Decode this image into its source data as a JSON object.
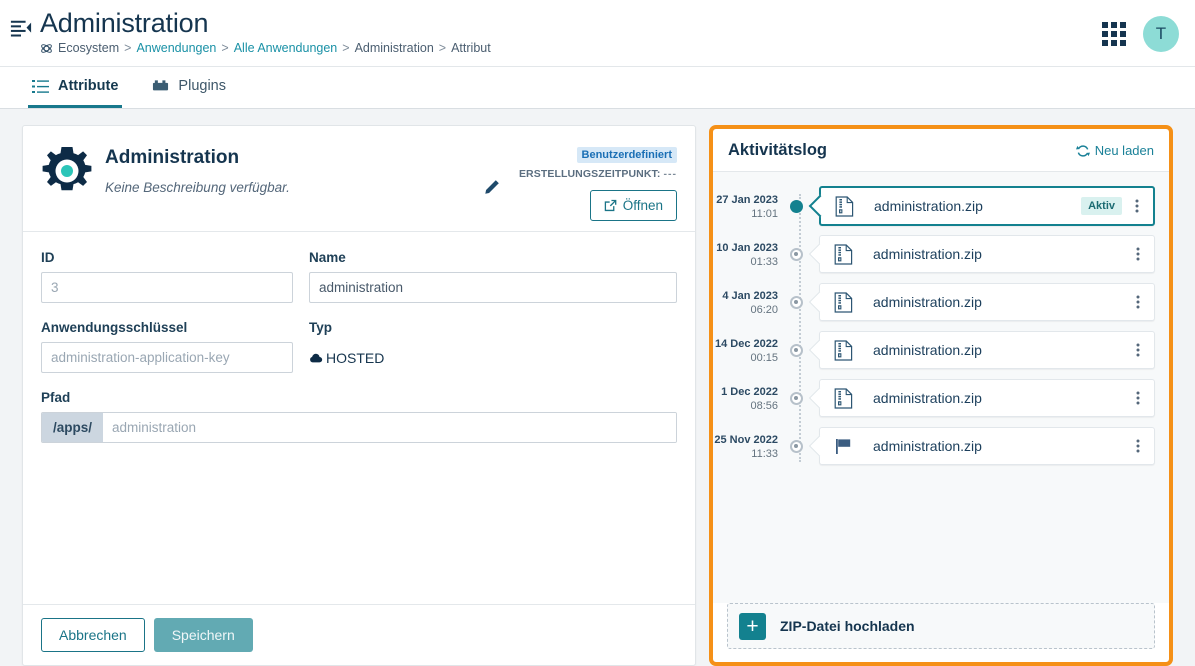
{
  "header": {
    "title": "Administration",
    "menu_icon": "collapse-menu-icon",
    "breadcrumb": [
      {
        "label": "Ecosystem",
        "link": false,
        "icon": "ecosystem-icon"
      },
      {
        "label": "Anwendungen",
        "link": true
      },
      {
        "label": "Alle Anwendungen",
        "link": true
      },
      {
        "label": "Administration",
        "link": false
      },
      {
        "label": "Attribut",
        "link": false
      }
    ],
    "separator": ">",
    "apps_grid_icon": "apps-grid-icon",
    "avatar_initial": "T"
  },
  "tabs": [
    {
      "label": "Attribute",
      "icon": "list-icon",
      "active": true
    },
    {
      "label": "Plugins",
      "icon": "plugin-brick-icon",
      "active": false
    }
  ],
  "app_card": {
    "icon": "gear-icon",
    "name": "Administration",
    "description": "Keine Beschreibung verfügbar.",
    "edit_icon": "pencil-icon",
    "badge": "Benutzerdefiniert",
    "created_label": "ERSTELLUNGSZEITPUNKT:",
    "created_value": "---",
    "open_button": "Öffnen",
    "open_icon": "external-link-icon"
  },
  "form": {
    "id": {
      "label": "ID",
      "value": "",
      "placeholder": "3"
    },
    "name": {
      "label": "Name",
      "value": "administration",
      "placeholder": ""
    },
    "app_key": {
      "label": "Anwendungsschlüssel",
      "value": "",
      "placeholder": "administration-application-key"
    },
    "type": {
      "label": "Typ",
      "value": "HOSTED",
      "icon": "cloud-icon"
    },
    "path": {
      "label": "Pfad",
      "prefix": "/apps/",
      "value": "",
      "placeholder": "administration"
    }
  },
  "footer": {
    "cancel": "Abbrechen",
    "save": "Speichern"
  },
  "activity_log": {
    "title": "Aktivitätslog",
    "reload_label": "Neu laden",
    "reload_icon": "refresh-icon",
    "kebab_icon": "kebab-menu-icon",
    "entries": [
      {
        "date": "27 Jan 2023",
        "time": "11:01",
        "file": "administration.zip",
        "icon": "zip-file-icon",
        "status": "Aktiv",
        "active": true
      },
      {
        "date": "10 Jan 2023",
        "time": "01:33",
        "file": "administration.zip",
        "icon": "zip-file-icon",
        "status": "",
        "active": false
      },
      {
        "date": "4 Jan 2023",
        "time": "06:20",
        "file": "administration.zip",
        "icon": "zip-file-icon",
        "status": "",
        "active": false
      },
      {
        "date": "14 Dec 2022",
        "time": "00:15",
        "file": "administration.zip",
        "icon": "zip-file-icon",
        "status": "",
        "active": false
      },
      {
        "date": "1 Dec 2022",
        "time": "08:56",
        "file": "administration.zip",
        "icon": "zip-file-icon",
        "status": "",
        "active": false
      },
      {
        "date": "25 Nov 2022",
        "time": "11:33",
        "file": "administration.zip",
        "icon": "flag-icon",
        "status": "",
        "active": false
      }
    ],
    "upload": {
      "label": "ZIP-Datei hochladen",
      "icon": "plus-icon"
    }
  },
  "colors": {
    "accent_teal": "#13818f",
    "highlight_orange": "#f59017",
    "navy": "#15354f",
    "badge_blue_bg": "#d6e8f7",
    "badge_blue_fg": "#1a6fb5",
    "badge_active_bg": "#d9f1ef",
    "avatar_bg": "#8ddcd6"
  }
}
